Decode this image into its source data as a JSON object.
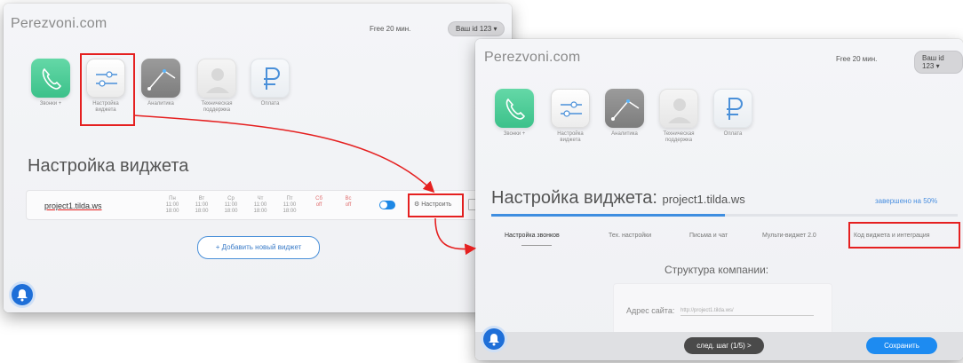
{
  "left_window": {
    "brand": "Perezvoni.com",
    "free_minutes": "Free 20 мин.",
    "user_id": "Ваш id 123 ▾",
    "tiles": [
      {
        "label": "Звонки +",
        "icon": "phone-icon"
      },
      {
        "label": "Настройка виджета",
        "icon": "sliders-icon"
      },
      {
        "label": "Аналитика",
        "icon": "chart-line-icon"
      },
      {
        "label": "Техническая поддержка",
        "icon": "person-icon"
      },
      {
        "label": "Оплата",
        "icon": "ruble-icon"
      }
    ],
    "page_title": "Настройка виджета",
    "widget": {
      "project": "project1.tilda.ws",
      "days": [
        {
          "name": "Пн",
          "from": "11:00",
          "to": "18:00"
        },
        {
          "name": "Вт",
          "from": "11:00",
          "to": "18:00"
        },
        {
          "name": "Ср",
          "from": "11:00",
          "to": "18:00"
        },
        {
          "name": "Чт",
          "from": "11:00",
          "to": "18:00"
        },
        {
          "name": "Пт",
          "from": "11:00",
          "to": "18:00"
        },
        {
          "name": "Сб",
          "from": "off",
          "to": ""
        },
        {
          "name": "Вс",
          "from": "off",
          "to": ""
        }
      ],
      "setup_label": "Настроить"
    },
    "add_widget": "+ Добавить новый виджет"
  },
  "right_window": {
    "brand": "Perezvoni.com",
    "free_minutes": "Free 20 мин.",
    "user_id": "Ваш id 123 ▾",
    "tiles": [
      {
        "label": "Звонки +",
        "icon": "phone-icon"
      },
      {
        "label": "Настройка виджета",
        "icon": "sliders-icon"
      },
      {
        "label": "Аналитика",
        "icon": "chart-line-icon"
      },
      {
        "label": "Техническая поддержка",
        "icon": "person-icon"
      },
      {
        "label": "Оплата",
        "icon": "ruble-icon"
      }
    ],
    "page_title": "Настройка виджета:",
    "project": "project1.tilda.ws",
    "completion": "завершено на 50%",
    "progress": 0.5,
    "tabs": [
      {
        "label": "Настройка звонков"
      },
      {
        "label": "Тех. настройки"
      },
      {
        "label": "Письма и чат"
      },
      {
        "label": "Мульти-виджет 2.0"
      },
      {
        "label": "Код виджета и интеграция"
      }
    ],
    "section_title": "Структура компании:",
    "site_label": "Адрес сайта:",
    "site_value": "http://project1.tilda.ws/",
    "next_step": "след. шаг (1/5) >",
    "save": "Сохранить"
  },
  "colors": {
    "accent_red": "#e52020",
    "accent_blue": "#1d8bf1",
    "tile_green": "#3cc18a"
  }
}
